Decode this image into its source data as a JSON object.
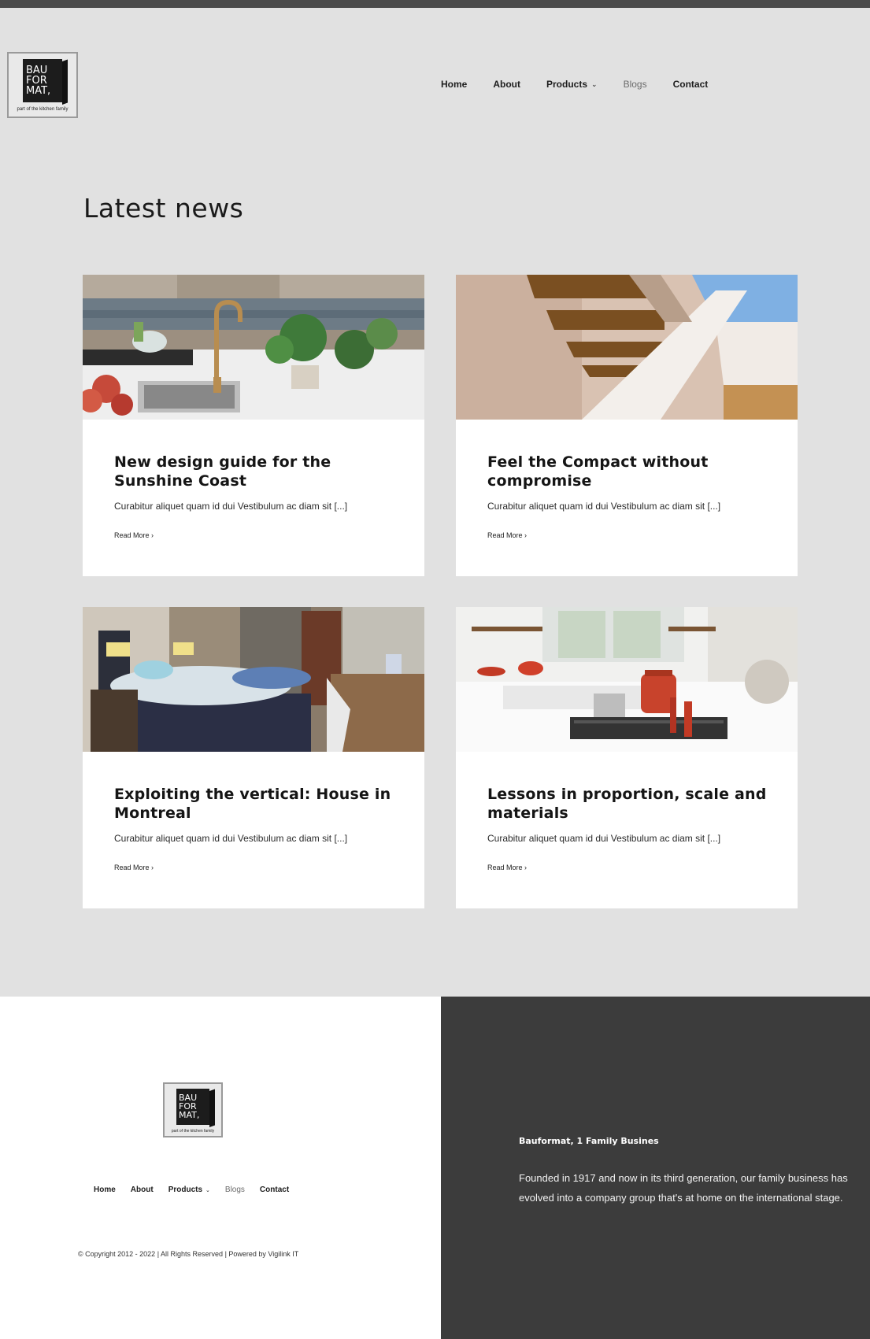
{
  "header": {
    "logo": {
      "line1": "BAU",
      "line2": "FOR",
      "line3": "MAT,",
      "tagline": "part of the kitchen family"
    },
    "nav": [
      {
        "label": "Home"
      },
      {
        "label": "About"
      },
      {
        "label": "Products"
      },
      {
        "label": "Blogs"
      },
      {
        "label": "Contact"
      }
    ]
  },
  "main": {
    "title": "Latest news",
    "posts": [
      {
        "title": "New design guide for the Sunshine Coast",
        "excerpt": "Curabitur aliquet quam id dui Vestibulum ac diam sit [...]",
        "read_more": "Read More"
      },
      {
        "title": "Feel the Compact without compromise",
        "excerpt": "Curabitur aliquet quam id dui Vestibulum ac diam sit [...]",
        "read_more": "Read More"
      },
      {
        "title": "Exploiting the vertical: House in Montreal",
        "excerpt": "Curabitur aliquet quam id dui Vestibulum ac diam sit [...]",
        "read_more": "Read More"
      },
      {
        "title": "Lessons in proportion, scale and materials",
        "excerpt": "Curabitur aliquet quam id dui Vestibulum ac diam sit [...]",
        "read_more": "Read More"
      }
    ]
  },
  "footer": {
    "logo": {
      "line1": "BAU",
      "line2": "FOR",
      "line3": "MAT,",
      "tagline": "part of the kitchen family"
    },
    "nav": [
      {
        "label": "Home"
      },
      {
        "label": "About"
      },
      {
        "label": "Products"
      },
      {
        "label": "Blogs"
      },
      {
        "label": "Contact"
      }
    ],
    "copyright": "© Copyright 2012 - 2022 | All Rights Reserved | Powered by Vigilink IT",
    "about_title": "Bauformat, 1 Family Busines",
    "about_text": "Founded in 1917 and now in its third generation, our family business has evolved into a company group that's at home on the international stage."
  },
  "icons": {
    "dropdown": "chevron-down-icon",
    "read_more": "chevron-right-icon"
  },
  "colors": {
    "page_bg": "#e1e1e1",
    "footer_dark": "#3c3c3c",
    "top_bar": "#4a4a4a"
  }
}
